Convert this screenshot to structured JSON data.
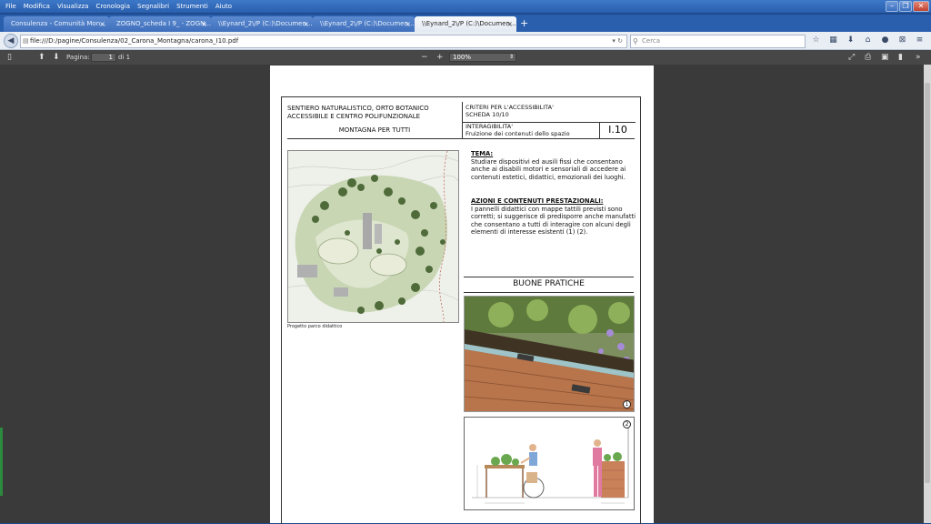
{
  "menu": [
    "File",
    "Modifica",
    "Visualizza",
    "Cronologia",
    "Segnalibri",
    "Strumenti",
    "Aiuto"
  ],
  "window_controls": {
    "minimize": "–",
    "maximize": "❐",
    "close": "✕"
  },
  "tabs": [
    {
      "label": "Consulenza - Comunità Mon...",
      "active": false
    },
    {
      "label": "ZOGNO_scheda I 9_ - ZOGN...",
      "active": false
    },
    {
      "label": "\\\\Eynard_2\\/P (C:)\\Documen...",
      "active": false
    },
    {
      "label": "\\\\Eynard_2\\/P (C:)\\Documen...",
      "active": false
    },
    {
      "label": "\\\\Eynard_2\\/P (C:)\\Documen...",
      "active": true
    }
  ],
  "new_tab": "+",
  "tab_close": "×",
  "address": {
    "url": "file:///D:/pagine/Consulenza/02_Carona_Montagna/carona_I10.pdf"
  },
  "search": {
    "placeholder": "Cerca"
  },
  "pdf_toolbar": {
    "page_label": "Pagina:",
    "page_current": "1",
    "page_total": "di 1",
    "zoom": "100%",
    "zoom_out": "−",
    "zoom_in": "+"
  },
  "doc": {
    "title_line1": "SENTIERO NATURALISTICO, ORTO BOTANICO",
    "title_line2": "ACCESSIBILE E CENTRO POLIFUNZIONALE",
    "title_line3": "MONTAGNA PER TUTTI",
    "criteria_line1": "CRITERI PER L'ACCESSIBILITA'",
    "criteria_line2": "SCHEDA 10/10",
    "section_line1": "INTERAGIBILITA'",
    "section_line2": "Fruizione dei contenuti dello spazio",
    "code": "I.10",
    "tema_heading": "TEMA:",
    "tema_text": "Studiare dispositivi ed ausili fissi che consentano anche ai disabili motori e sensoriali di accedere ai contenuti estetici, didattici, emozionali dei luoghi.",
    "azioni_heading": "AZIONI E CONTENUTI PRESTAZIONALI:",
    "azioni_text": "I pannelli didattici con mappe tattili previsti  sono corretti; si suggerisce di predisporre anche manufatti che consentano a tutti di interagire con alcuni degli elementi di interesse esistenti (1) (2).",
    "plan_caption": "Progetto parco didattico",
    "buone_pratiche": "BUONE PRATICHE",
    "photo1_num": "1",
    "photo2_num": "2"
  },
  "colors": {
    "viewer_bg": "#3a3a3a",
    "toolbar_bg": "#474747",
    "titlebar": "#2a5fae"
  }
}
